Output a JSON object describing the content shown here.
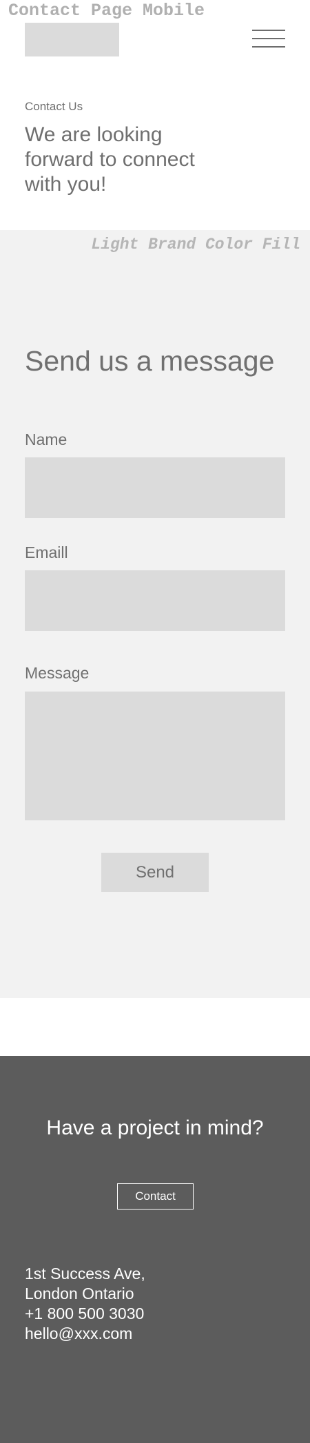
{
  "page_label": "Contact Page Mobile",
  "header": {
    "logo_alt": "",
    "menu_icon": "hamburger-menu-icon"
  },
  "hero": {
    "eyebrow": "Contact Us",
    "title": "We are looking forward to connect with you!"
  },
  "form_section": {
    "fill_note": "Light Brand Color Fill",
    "title": "Send us a message",
    "fields": {
      "name_label": "Name",
      "name_value": "",
      "email_label": "Emaill",
      "email_value": "",
      "message_label": "Message",
      "message_value": ""
    },
    "send_label": "Send"
  },
  "footer": {
    "title": "Have a project in mind?",
    "contact_label": "Contact",
    "address_line1": "1st Success Ave,",
    "address_line2": "London Ontario",
    "phone": "+1 800 500 3030",
    "email": "hello@xxx.com"
  },
  "colors": {
    "section_fill": "#f2f2f2",
    "placeholder_fill": "#dbdbdb",
    "footer_fill": "#5c5c5c",
    "text_gray": "#707070"
  }
}
